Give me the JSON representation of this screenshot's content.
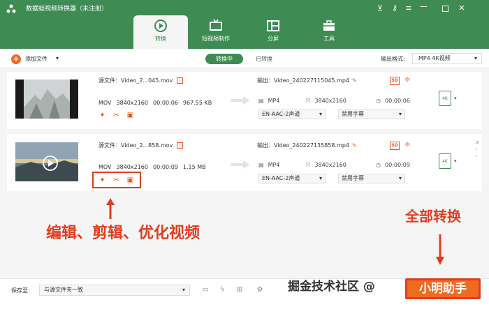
{
  "app": {
    "title": "数据蛙视频转换器（未注册）",
    "accent": "#3e8c53",
    "orange": "#f06a1f",
    "annotation_color": "#e23c1e"
  },
  "window_controls": [
    "cart-icon",
    "key-icon",
    "menu-icon",
    "minimize-icon",
    "maximize-icon",
    "close-icon"
  ],
  "tabs": [
    {
      "label": "转换",
      "icon": "convert-icon",
      "active": true
    },
    {
      "label": "短视频制作",
      "icon": "tv-icon",
      "active": false
    },
    {
      "label": "分屏",
      "icon": "split-screen-icon",
      "active": false
    },
    {
      "label": "工具",
      "icon": "toolbox-icon",
      "active": false
    }
  ],
  "toolbar": {
    "add_file": "添加文件",
    "seg_converting": "转换中",
    "seg_converted": "已转换",
    "output_format_label": "输出格式:",
    "output_format_value": "MP4 4K视频"
  },
  "files": [
    {
      "source": "源文件：Video_2...045.mov",
      "format": "MOV",
      "resolution": "3840x2160",
      "duration": "00:00:06",
      "size": "967.55 KB",
      "output": "输出：Video_240227115045.mp4",
      "out_format": "MP4",
      "out_resolution": "3840x2160",
      "out_duration": "00:00:06",
      "audio": "EN-AAC-2声道",
      "subtitle": "禁用字幕",
      "format_badge": "4K"
    },
    {
      "source": "源文件：Video_2...858.mov",
      "format": "MOV",
      "resolution": "3840x2160",
      "duration": "00:00:09",
      "size": "1.15 MB",
      "output": "输出：Video_240227135858.mp4",
      "out_format": "MP4",
      "out_resolution": "3840x2160",
      "out_duration": "00:00:09",
      "audio": "EN-AAC-2声道",
      "subtitle": "禁用字幕",
      "format_badge": "4K"
    }
  ],
  "annotations": {
    "edit_text": "编辑、剪辑、优化视频",
    "convert_text": "全部转换"
  },
  "bottom": {
    "save_to_label": "保存至:",
    "save_to_value": "与源文件夹一致",
    "convert_all": "小明助手",
    "watermark": "掘金技术社区 @"
  }
}
